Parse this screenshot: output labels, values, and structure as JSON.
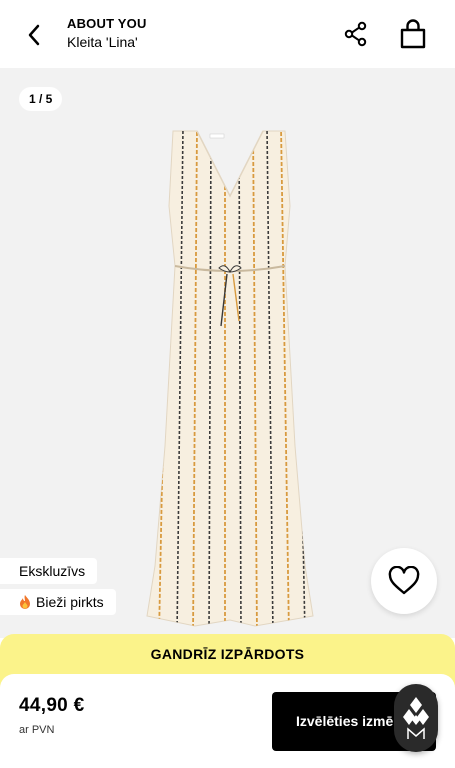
{
  "header": {
    "brand": "ABOUT YOU",
    "product_name": "Kleita 'Lina'",
    "icons": {
      "back": "chevron-left-icon",
      "share": "share-icon",
      "bag": "shopping-bag-icon"
    }
  },
  "gallery": {
    "counter": "1 / 5",
    "current_image": 1,
    "total_images": 5,
    "badges": {
      "exclusive": "Ekskluzīvs",
      "popular": "Bieži pirkts"
    },
    "wishlist_icon": "heart-icon"
  },
  "stock_banner": "GANDRĪZ IZPĀRDOTS",
  "purchase": {
    "price": "44,90 €",
    "vat_note": "ar PVN",
    "select_size_label": "Izvēlēties izmē"
  },
  "colors": {
    "banner": "#fbf38a",
    "button": "#000000",
    "gallery_bg": "#f2f2f2"
  }
}
